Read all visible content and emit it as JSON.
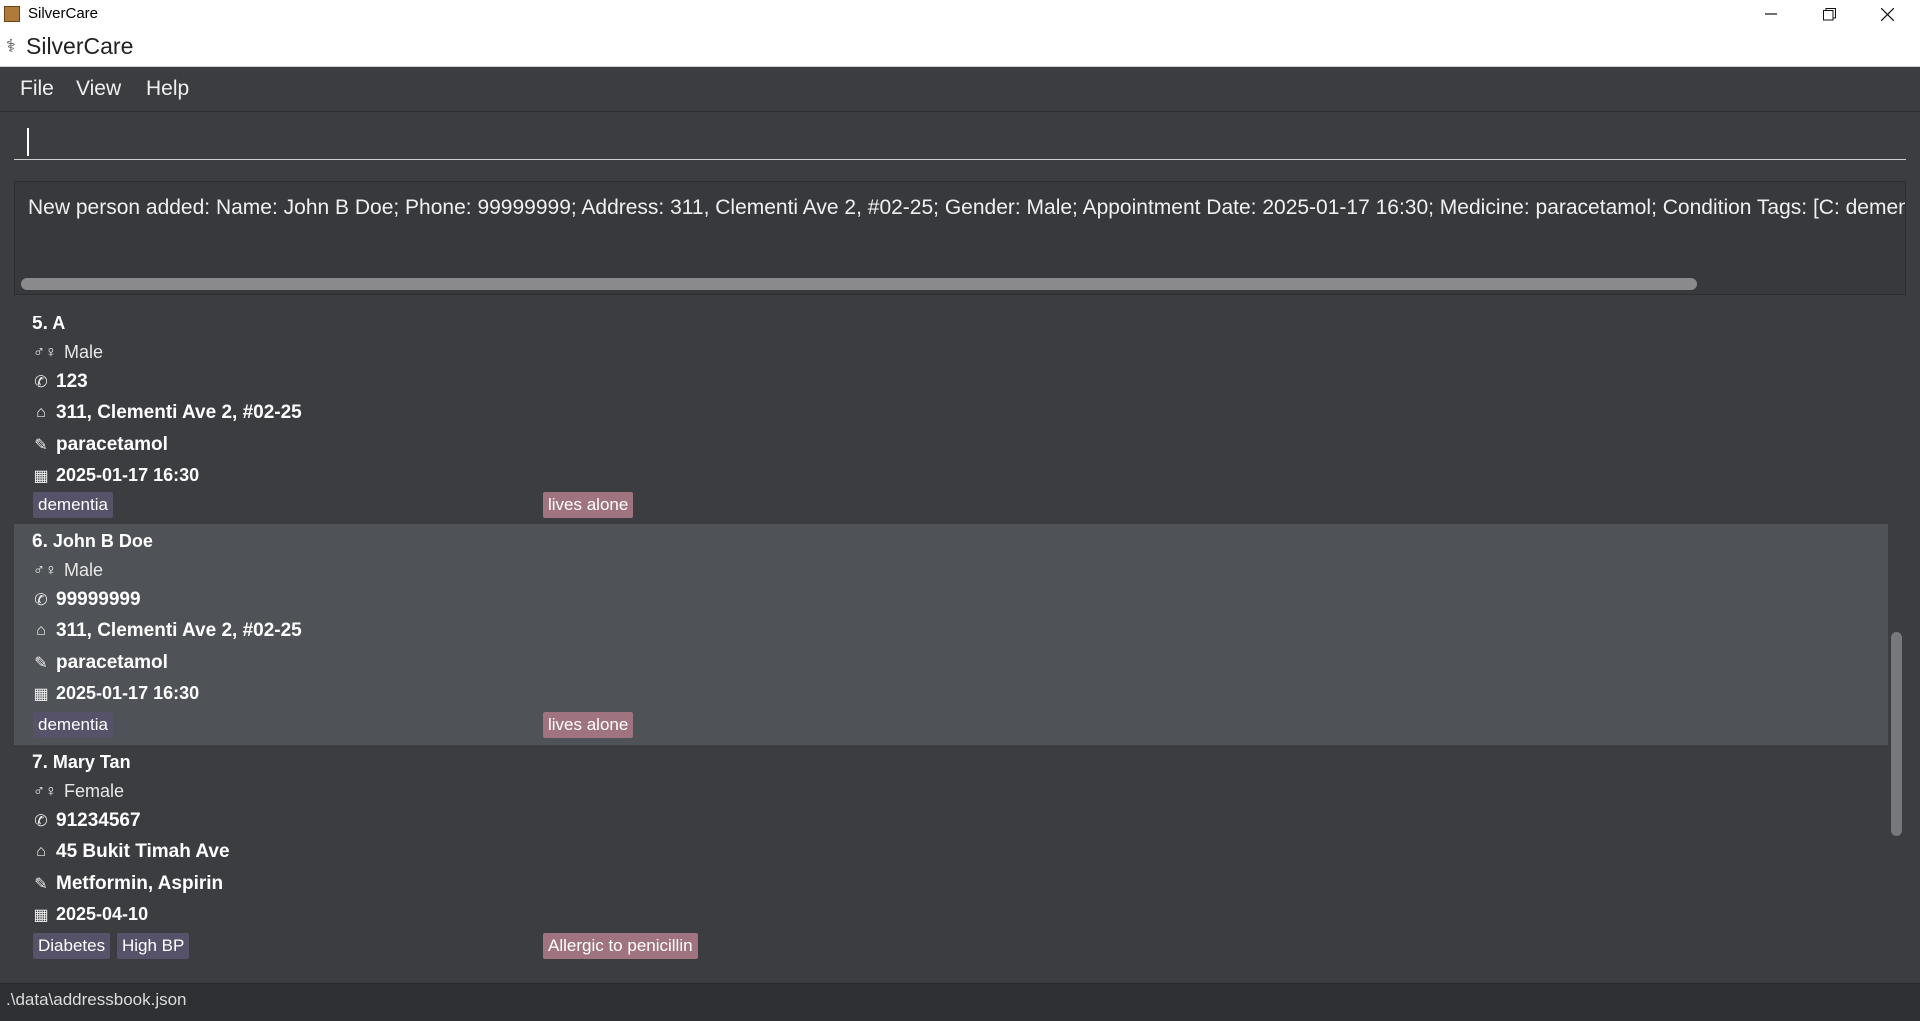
{
  "window": {
    "title": "SilverCare",
    "controls": [
      "minimize-icon",
      "restore-icon",
      "close-icon"
    ]
  },
  "header": {
    "icon": "caduceus-icon",
    "title": "SilverCare"
  },
  "menu": {
    "file": "File",
    "view": "View",
    "help": "Help"
  },
  "command": {
    "value": "",
    "placeholder": ""
  },
  "result": {
    "text": "New person added: Name: John B Doe; Phone: 99999999; Address: 311, Clementi Ave 2, #02-25; Gender: Male; Appointment Date: 2025-01-17 16:30; Medicine: paracetamol; Condition Tags: [C: dementia]; De"
  },
  "persons": [
    {
      "index": "5.",
      "name": "A",
      "gender": "Male",
      "phone": "123",
      "address": "311, Clementi Ave 2, #02-25",
      "medicine": "paracetamol",
      "appointment": "2025-01-17 16:30",
      "condition_tags": [
        "dementia"
      ],
      "note_tags": [
        "lives alone"
      ]
    },
    {
      "index": "6.",
      "name": "John B Doe",
      "gender": "Male",
      "phone": "99999999",
      "address": "311, Clementi Ave 2, #02-25",
      "medicine": "paracetamol",
      "appointment": "2025-01-17 16:30",
      "condition_tags": [
        "dementia"
      ],
      "note_tags": [
        "lives alone"
      ]
    },
    {
      "index": "7.",
      "name": "Mary Tan",
      "gender": "Female",
      "phone": "91234567",
      "address": "45 Bukit Timah Ave",
      "medicine": "Metformin, Aspirin",
      "appointment": "2025-04-10",
      "condition_tags": [
        "Diabetes",
        "High BP"
      ],
      "note_tags": [
        "Allergic to penicillin"
      ]
    }
  ],
  "icons": {
    "gender": "gender-icon",
    "phone": "phone-icon",
    "address": "home-icon",
    "medicine": "pill-icon",
    "appointment": "calendar-icon"
  },
  "status": {
    "path": ".\\data\\addressbook.json"
  },
  "colors": {
    "background": "#3c3d40",
    "selected_row": "#4f5357",
    "condition_tag": "#56526a",
    "note_tag": "#9f7480"
  }
}
